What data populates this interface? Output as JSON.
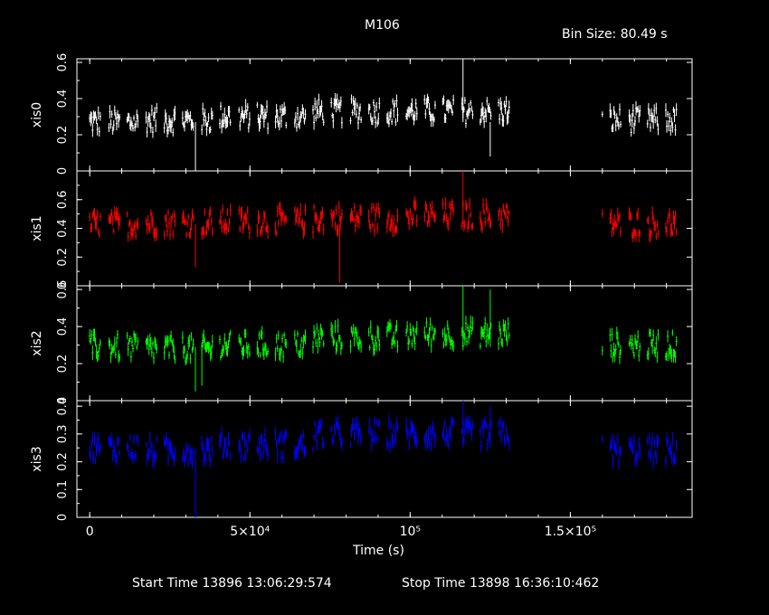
{
  "header": {
    "title": "M106",
    "bin_size": "Bin Size: 80.49 s"
  },
  "footer": {
    "start_time": "Start Time 13896 13:06:29:574",
    "stop_time": "Stop Time 13898 16:36:10:462"
  },
  "chart_data": [
    {
      "type": "line",
      "ylabel": "xis0",
      "color": "#ffffff",
      "ylim": [
        0,
        0.62
      ],
      "yticks": [
        0,
        0.2,
        0.4,
        0.6
      ],
      "ytick_labels": [
        "0",
        "0.2",
        "0.4",
        "0.6"
      ],
      "xlim": [
        -4000,
        188000
      ],
      "segments": [
        {
          "x": [
            0,
            17000.0
          ],
          "mean": 0.27
        },
        {
          "x": [
            17000.0,
            40000.0
          ],
          "mean": 0.28
        },
        {
          "x": [
            40000.0,
            70000.0
          ],
          "mean": 0.3
        },
        {
          "x": [
            70000.0,
            100000.0
          ],
          "mean": 0.33
        },
        {
          "x": [
            100000.0,
            133000.0
          ],
          "mean": 0.33
        },
        {
          "x": [
            160000.0,
            184000.0
          ],
          "mean": 0.28
        }
      ],
      "spikes": [
        {
          "x": 33000.0,
          "y": 0.0
        },
        {
          "x": 116500.0,
          "y": 0.62
        },
        {
          "x": 125000.0,
          "y": 0.08
        }
      ]
    },
    {
      "type": "line",
      "ylabel": "xis1",
      "color": "#ff0000",
      "ylim": [
        0,
        0.8
      ],
      "yticks": [
        0,
        0.2,
        0.4,
        0.6
      ],
      "ytick_labels": [
        "0",
        "0.2",
        "0.4",
        "0.6"
      ],
      "xlim": [
        -4000,
        188000
      ],
      "segments": [
        {
          "x": [
            0,
            17000.0
          ],
          "mean": 0.43
        },
        {
          "x": [
            17000.0,
            40000.0
          ],
          "mean": 0.44
        },
        {
          "x": [
            40000.0,
            70000.0
          ],
          "mean": 0.45
        },
        {
          "x": [
            70000.0,
            100000.0
          ],
          "mean": 0.47
        },
        {
          "x": [
            100000.0,
            133000.0
          ],
          "mean": 0.49
        },
        {
          "x": [
            160000.0,
            184000.0
          ],
          "mean": 0.43
        }
      ],
      "spikes": [
        {
          "x": 33000.0,
          "y": 0.13
        },
        {
          "x": 78000.0,
          "y": 0.02
        },
        {
          "x": 116500.0,
          "y": 0.8
        }
      ]
    },
    {
      "type": "line",
      "ylabel": "xis2",
      "color": "#00ff00",
      "ylim": [
        0,
        0.62
      ],
      "yticks": [
        0,
        0.2,
        0.4,
        0.6
      ],
      "ytick_labels": [
        "0",
        "0.2",
        "0.4",
        "0.6"
      ],
      "xlim": [
        -4000,
        188000
      ],
      "segments": [
        {
          "x": [
            0,
            17000.0
          ],
          "mean": 0.29
        },
        {
          "x": [
            17000.0,
            40000.0
          ],
          "mean": 0.28
        },
        {
          "x": [
            40000.0,
            70000.0
          ],
          "mean": 0.3
        },
        {
          "x": [
            70000.0,
            100000.0
          ],
          "mean": 0.34
        },
        {
          "x": [
            100000.0,
            133000.0
          ],
          "mean": 0.36
        },
        {
          "x": [
            160000.0,
            184000.0
          ],
          "mean": 0.3
        }
      ],
      "spikes": [
        {
          "x": 33000.0,
          "y": 0.05
        },
        {
          "x": 35000.0,
          "y": 0.08
        },
        {
          "x": 116500.0,
          "y": 0.62
        },
        {
          "x": 125000.0,
          "y": 0.6
        }
      ]
    },
    {
      "type": "line",
      "ylabel": "xis3",
      "color": "#0000ff",
      "ylim": [
        0,
        0.42
      ],
      "yticks": [
        0,
        0.1,
        0.2,
        0.3,
        0.4
      ],
      "ytick_labels": [
        "0",
        "0.1",
        "0.2",
        "0.3",
        "0.4"
      ],
      "xlim": [
        -4000,
        188000
      ],
      "segments": [
        {
          "x": [
            0,
            17000.0
          ],
          "mean": 0.25
        },
        {
          "x": [
            17000.0,
            40000.0
          ],
          "mean": 0.24
        },
        {
          "x": [
            40000.0,
            70000.0
          ],
          "mean": 0.26
        },
        {
          "x": [
            70000.0,
            100000.0
          ],
          "mean": 0.3
        },
        {
          "x": [
            100000.0,
            133000.0
          ],
          "mean": 0.3
        },
        {
          "x": [
            160000.0,
            184000.0
          ],
          "mean": 0.24
        }
      ],
      "spikes": [
        {
          "x": 33000.0,
          "y": 0.0
        },
        {
          "x": 116500.0,
          "y": 0.42
        },
        {
          "x": 125000.0,
          "y": 0.4
        }
      ]
    }
  ],
  "xaxis": {
    "label": "Time (s)",
    "ticks": [
      0,
      50000,
      100000,
      150000
    ],
    "tick_labels": [
      "0",
      "5×10⁴",
      "10⁵",
      "1.5×10⁵"
    ]
  }
}
